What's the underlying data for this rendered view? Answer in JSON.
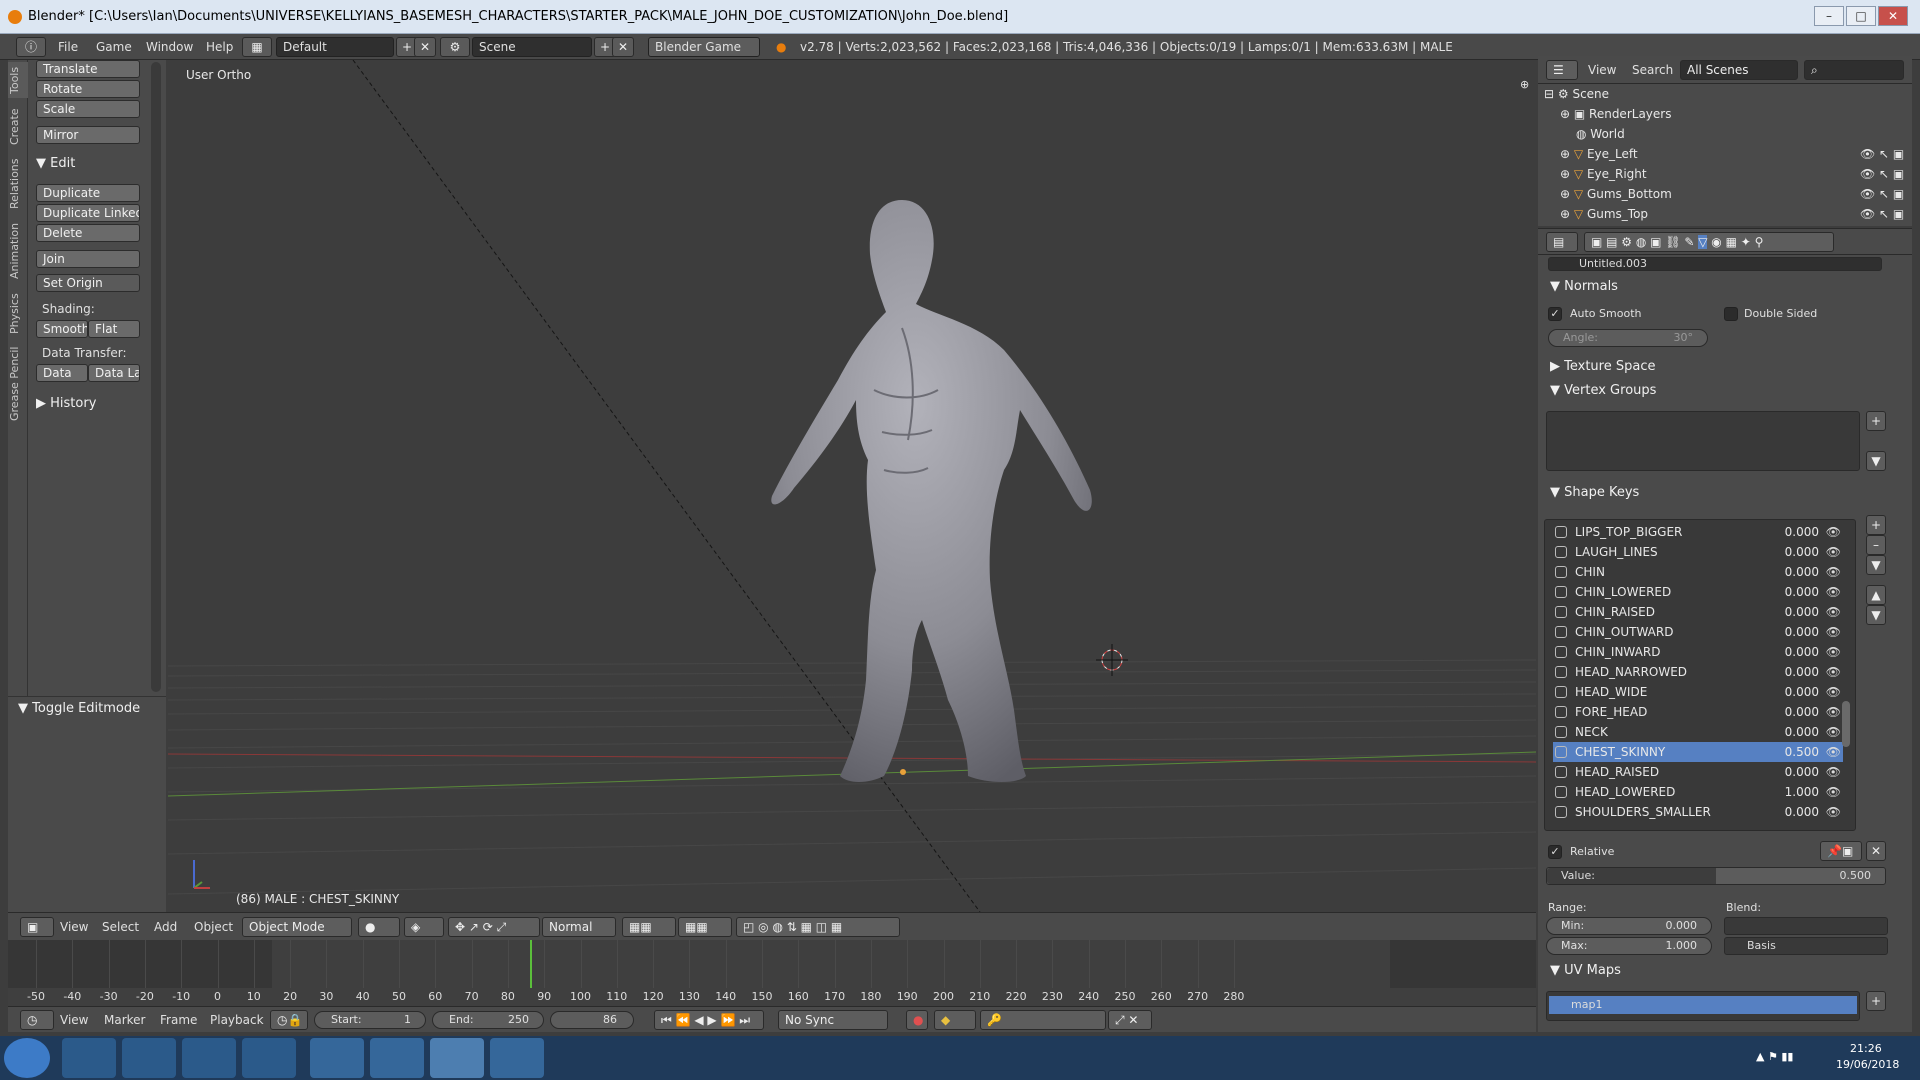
{
  "window": {
    "title": "Blender* [C:\\Users\\Ian\\Documents\\UNIVERSE\\KELLYIANS_BASEMESH_CHARACTERS\\STARTER_PACK\\MALE_JOHN_DOE_CUSTOMIZATION\\John_Doe.blend]"
  },
  "infobar": {
    "menus": [
      "File",
      "Game",
      "Window",
      "Help"
    ],
    "screen_layout": "Default",
    "scene": "Scene",
    "engine": "Blender Game",
    "stats": "v2.78 | Verts:2,023,562 | Faces:2,023,168 | Tris:4,046,336 | Objects:0/19 | Lamps:0/1 | Mem:633.63M | MALE"
  },
  "tool_tabs": [
    "Tools",
    "Create",
    "Relations",
    "Animation",
    "Physics",
    "Grease Pencil"
  ],
  "toolshelf": {
    "transform": [
      "Translate",
      "Rotate",
      "Scale"
    ],
    "mirror": "Mirror",
    "edit_header": "Edit",
    "edit": [
      "Duplicate",
      "Duplicate Linked",
      "Delete"
    ],
    "join": "Join",
    "set_origin": "Set Origin",
    "shading_label": "Shading:",
    "smooth": "Smooth",
    "flat": "Flat",
    "data_transfer_label": "Data Transfer:",
    "data": "Data",
    "data_layers": "Data La",
    "history": "History",
    "toggle_editmode": "Toggle Editmode"
  },
  "viewport": {
    "view_name": "User Ortho",
    "object_info": "(86) MALE : CHEST_SKINNY"
  },
  "viewport_header": {
    "menus": [
      "View",
      "Select",
      "Add",
      "Object"
    ],
    "mode": "Object Mode",
    "orientation": "Normal"
  },
  "timeline": {
    "ticks": [
      "-50",
      "-40",
      "-30",
      "-20",
      "-10",
      "0",
      "10",
      "20",
      "30",
      "40",
      "50",
      "60",
      "70",
      "80",
      "90",
      "100",
      "110",
      "120",
      "130",
      "140",
      "150",
      "160",
      "170",
      "180",
      "190",
      "200",
      "210",
      "220",
      "230",
      "240",
      "250",
      "260",
      "270",
      "280"
    ],
    "current_frame": 86,
    "menus": [
      "View",
      "Marker",
      "Frame",
      "Playback"
    ],
    "start_label": "Start:",
    "start": "1",
    "end_label": "End:",
    "end": "250",
    "frame": "86",
    "sync": "No Sync"
  },
  "outliner": {
    "menus": [
      "View",
      "Search"
    ],
    "filter": "All Scenes",
    "items": [
      "Scene",
      "RenderLayers",
      "World",
      "Eye_Left",
      "Eye_Right",
      "Gums_Bottom",
      "Gums_Top"
    ]
  },
  "properties": {
    "mesh_name": "Untitled.003",
    "normals": {
      "header": "Normals",
      "auto_smooth": "Auto Smooth",
      "double_sided": "Double Sided",
      "angle_label": "Angle:",
      "angle": "30°"
    },
    "texture_space": "Texture Space",
    "vertex_groups": "Vertex Groups",
    "shape_keys": {
      "header": "Shape Keys",
      "items": [
        {
          "name": "LIPS_TOP_BIGGER",
          "value": "0.000"
        },
        {
          "name": "LAUGH_LINES",
          "value": "0.000"
        },
        {
          "name": "CHIN",
          "value": "0.000"
        },
        {
          "name": "CHIN_LOWERED",
          "value": "0.000"
        },
        {
          "name": "CHIN_RAISED",
          "value": "0.000"
        },
        {
          "name": "CHIN_OUTWARD",
          "value": "0.000"
        },
        {
          "name": "CHIN_INWARD",
          "value": "0.000"
        },
        {
          "name": "HEAD_NARROWED",
          "value": "0.000"
        },
        {
          "name": "HEAD_WIDE",
          "value": "0.000"
        },
        {
          "name": "FORE_HEAD",
          "value": "0.000"
        },
        {
          "name": "NECK",
          "value": "0.000"
        },
        {
          "name": "CHEST_SKINNY",
          "value": "0.500"
        },
        {
          "name": "HEAD_RAISED",
          "value": "0.000"
        },
        {
          "name": "HEAD_LOWERED",
          "value": "1.000"
        },
        {
          "name": "SHOULDERS_SMALLER",
          "value": "0.000"
        }
      ],
      "selected": "CHEST_SKINNY",
      "relative": "Relative",
      "value_label": "Value:",
      "value": "0.500",
      "value_fraction": 0.5,
      "range_label": "Range:",
      "min_label": "Min:",
      "min": "0.000",
      "max_label": "Max:",
      "max": "1.000",
      "blend_label": "Blend:",
      "basis": "Basis"
    },
    "uv_maps": {
      "header": "UV Maps",
      "item": "map1"
    }
  },
  "taskbar": {
    "time": "21:26",
    "date": "19/06/2018"
  }
}
